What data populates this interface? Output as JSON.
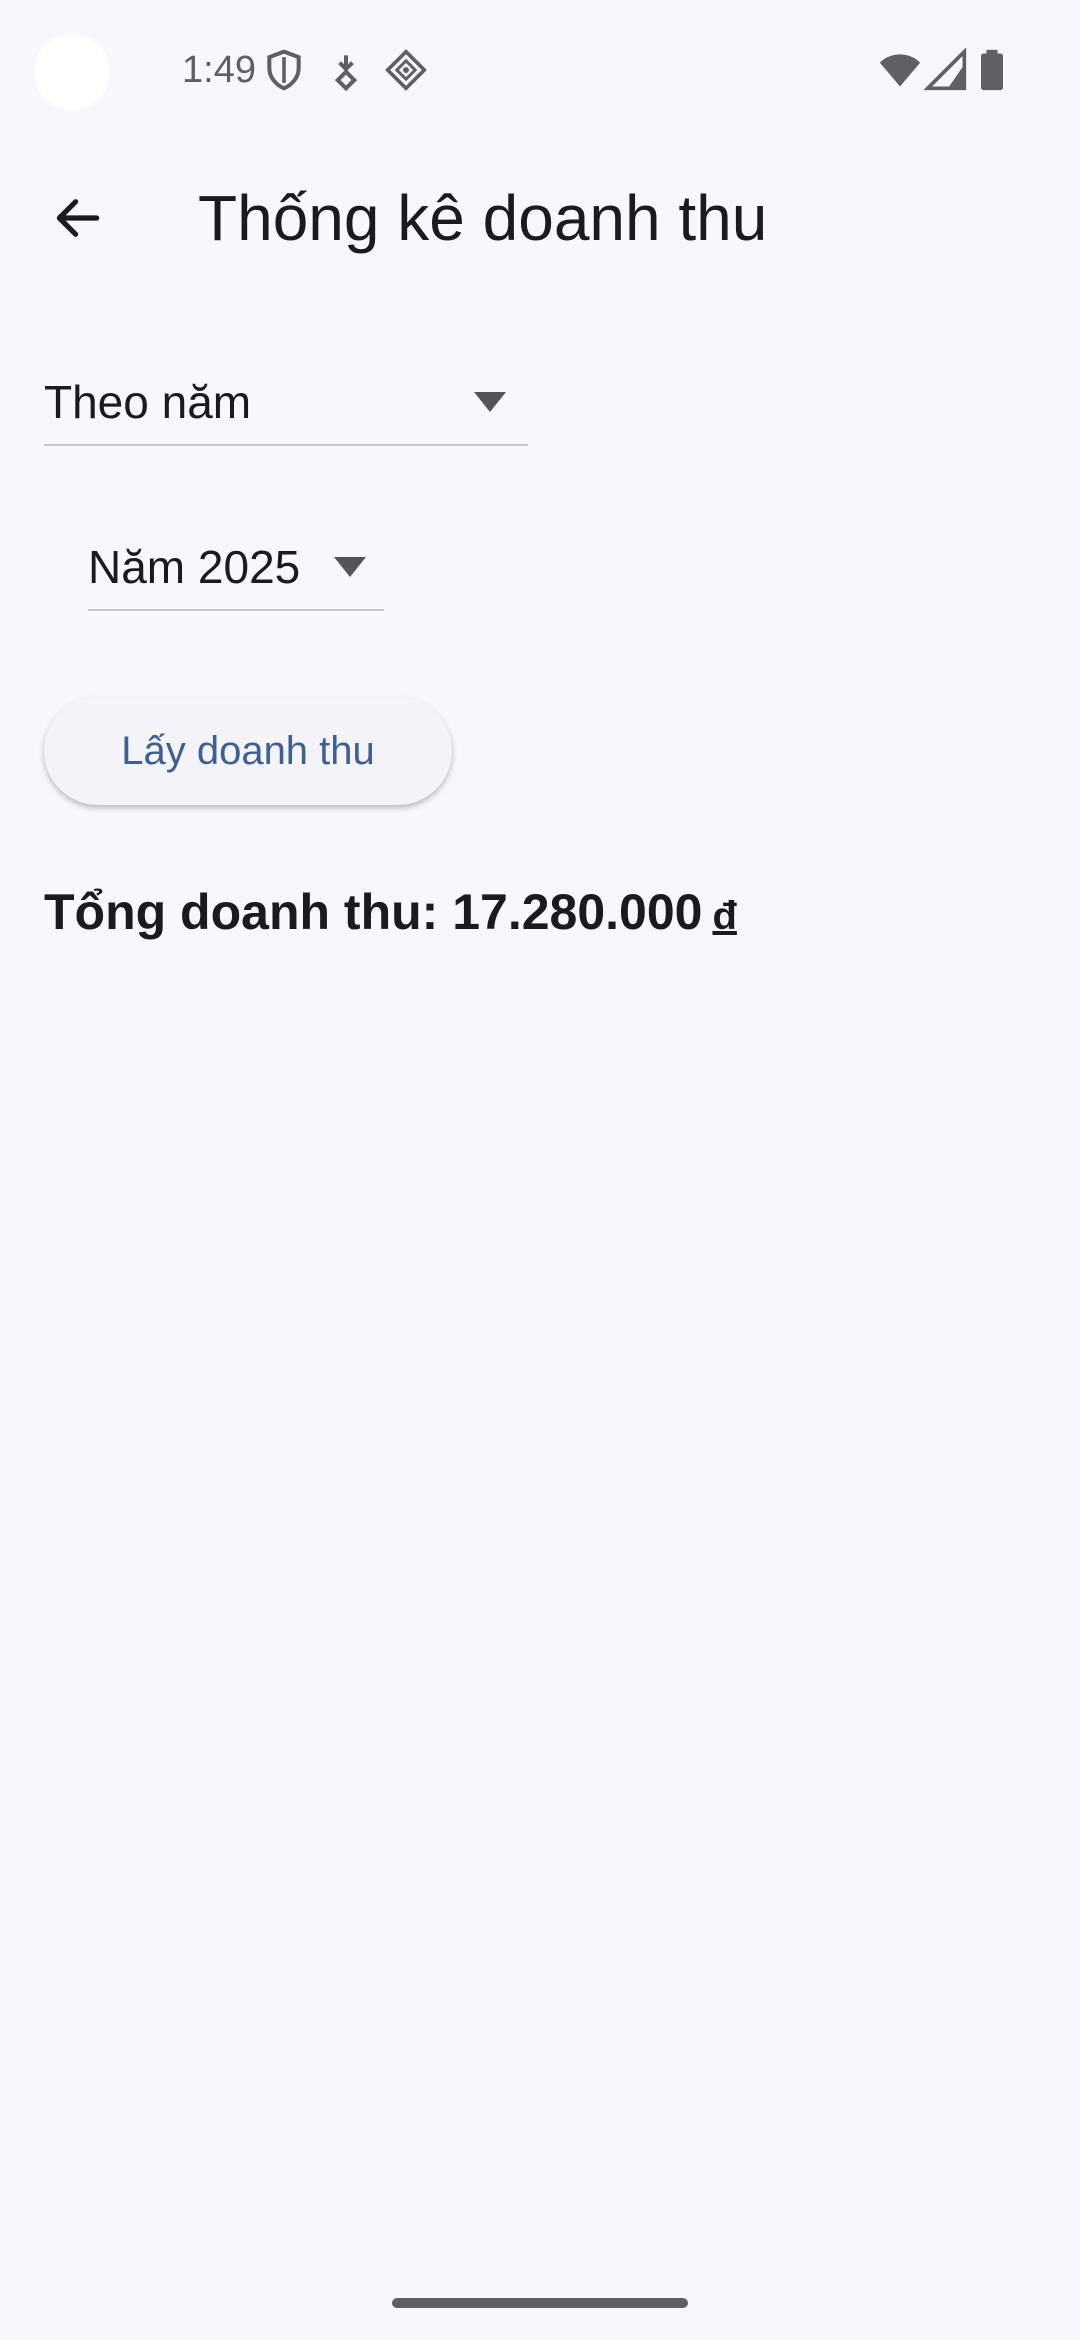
{
  "status_bar": {
    "time": "1:49",
    "left_icons": [
      "shield-icon",
      "download-icon",
      "location-diamond-icon"
    ],
    "right_icons": [
      "wifi-icon",
      "cell-signal-icon",
      "battery-icon"
    ]
  },
  "app_bar": {
    "back_icon": "arrow-back-icon",
    "title": "Thống kê doanh thu"
  },
  "filters": {
    "mode": {
      "value": "Theo năm"
    },
    "year": {
      "value": "Năm 2025"
    }
  },
  "actions": {
    "fetch_label": "Lấy doanh thu"
  },
  "result": {
    "label": "Tổng doanh thu: 17.280.000",
    "currency": "đ"
  },
  "colors": {
    "background": "#f8f7fd",
    "button_text": "#3e5f90",
    "text_primary": "#1b1b1f",
    "status_icons": "#5f5f66"
  }
}
